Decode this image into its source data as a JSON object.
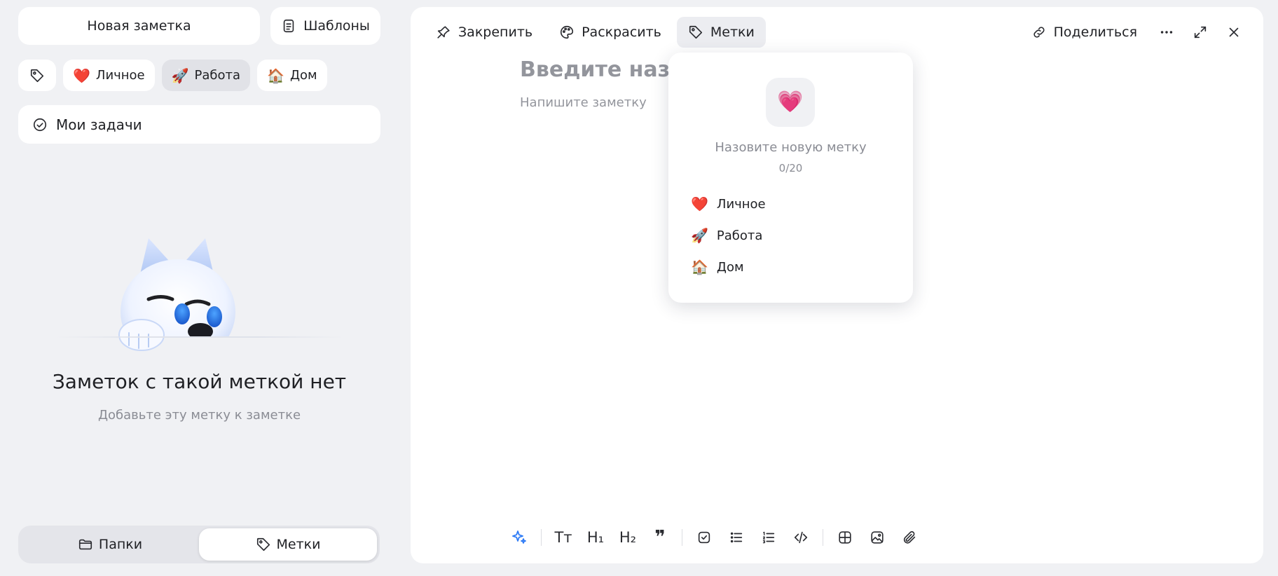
{
  "sidebar": {
    "new_note_label": "Новая заметка",
    "templates_label": "Шаблоны",
    "chips": [
      {
        "emoji": "❤️",
        "label": "Личное"
      },
      {
        "emoji": "🚀",
        "label": "Работа"
      },
      {
        "emoji": "🏠",
        "label": "Дом"
      }
    ],
    "active_chip": "Работа",
    "my_tasks_label": "Мои задачи",
    "empty_title": "Заметок с такой меткой нет",
    "empty_subtitle": "Добавьте эту метку к заметке",
    "segments": [
      {
        "label": "Папки",
        "icon": "folder-icon"
      },
      {
        "label": "Метки",
        "icon": "tag-icon"
      }
    ],
    "active_segment": "Метки"
  },
  "toolbar": {
    "pin_label": "Закрепить",
    "color_label": "Раскрасить",
    "tags_label": "Метки",
    "share_label": "Поделиться"
  },
  "note": {
    "title_placeholder": "Введите назва",
    "body_placeholder": "Напишите заметку"
  },
  "tag_dropdown": {
    "selected_emoji": "💗",
    "name_placeholder": "Назовите новую метку",
    "counter": "0/20",
    "tags": [
      {
        "emoji": "❤️",
        "label": "Личное"
      },
      {
        "emoji": "🚀",
        "label": "Работа"
      },
      {
        "emoji": "🏠",
        "label": "Дом"
      }
    ]
  },
  "format_bar": {
    "text_style": "Тт",
    "h1": "H₁",
    "h2": "H₂",
    "quote": "❞"
  },
  "colors": {
    "background": "#f0f1f4",
    "panel": "#ffffff",
    "accent_blue": "#2f7cf6",
    "muted_text": "#8a8c94"
  }
}
